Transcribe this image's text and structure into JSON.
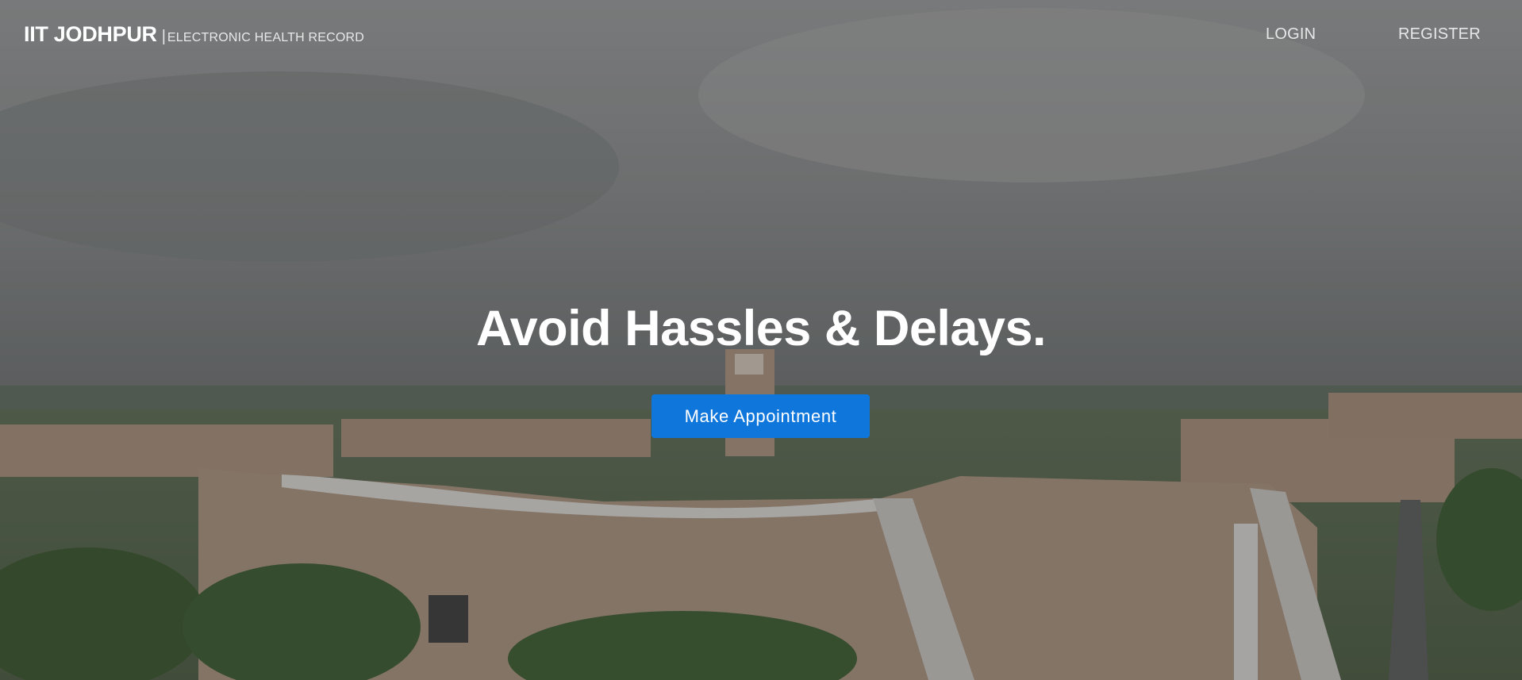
{
  "brand": {
    "title": "IIT JODHPUR",
    "divider": "|",
    "subtitle": "ELECTRONIC HEALTH RECORD"
  },
  "nav": {
    "login": "LOGIN",
    "register": "REGISTER"
  },
  "hero": {
    "headline": "Avoid Hassles & Delays.",
    "cta": "Make Appointment"
  },
  "colors": {
    "cta_blue": "#0f76dc",
    "overlay": "#6f6f6f",
    "brick": "#a58b77"
  }
}
